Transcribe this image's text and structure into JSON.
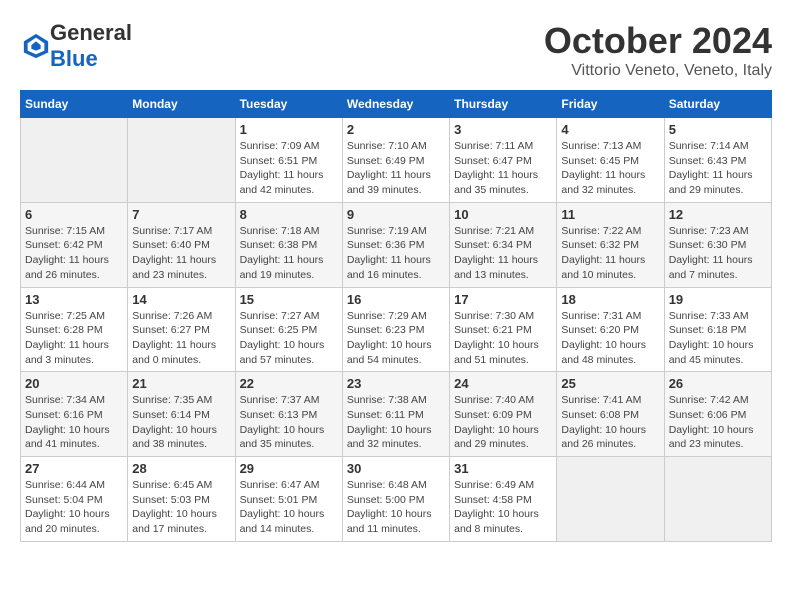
{
  "header": {
    "logo_general": "General",
    "logo_blue": "Blue",
    "month": "October 2024",
    "location": "Vittorio Veneto, Veneto, Italy"
  },
  "weekdays": [
    "Sunday",
    "Monday",
    "Tuesday",
    "Wednesday",
    "Thursday",
    "Friday",
    "Saturday"
  ],
  "weeks": [
    [
      {
        "day": "",
        "empty": true
      },
      {
        "day": "",
        "empty": true
      },
      {
        "day": "1",
        "sunrise": "Sunrise: 7:09 AM",
        "sunset": "Sunset: 6:51 PM",
        "daylight": "Daylight: 11 hours and 42 minutes."
      },
      {
        "day": "2",
        "sunrise": "Sunrise: 7:10 AM",
        "sunset": "Sunset: 6:49 PM",
        "daylight": "Daylight: 11 hours and 39 minutes."
      },
      {
        "day": "3",
        "sunrise": "Sunrise: 7:11 AM",
        "sunset": "Sunset: 6:47 PM",
        "daylight": "Daylight: 11 hours and 35 minutes."
      },
      {
        "day": "4",
        "sunrise": "Sunrise: 7:13 AM",
        "sunset": "Sunset: 6:45 PM",
        "daylight": "Daylight: 11 hours and 32 minutes."
      },
      {
        "day": "5",
        "sunrise": "Sunrise: 7:14 AM",
        "sunset": "Sunset: 6:43 PM",
        "daylight": "Daylight: 11 hours and 29 minutes."
      }
    ],
    [
      {
        "day": "6",
        "sunrise": "Sunrise: 7:15 AM",
        "sunset": "Sunset: 6:42 PM",
        "daylight": "Daylight: 11 hours and 26 minutes."
      },
      {
        "day": "7",
        "sunrise": "Sunrise: 7:17 AM",
        "sunset": "Sunset: 6:40 PM",
        "daylight": "Daylight: 11 hours and 23 minutes."
      },
      {
        "day": "8",
        "sunrise": "Sunrise: 7:18 AM",
        "sunset": "Sunset: 6:38 PM",
        "daylight": "Daylight: 11 hours and 19 minutes."
      },
      {
        "day": "9",
        "sunrise": "Sunrise: 7:19 AM",
        "sunset": "Sunset: 6:36 PM",
        "daylight": "Daylight: 11 hours and 16 minutes."
      },
      {
        "day": "10",
        "sunrise": "Sunrise: 7:21 AM",
        "sunset": "Sunset: 6:34 PM",
        "daylight": "Daylight: 11 hours and 13 minutes."
      },
      {
        "day": "11",
        "sunrise": "Sunrise: 7:22 AM",
        "sunset": "Sunset: 6:32 PM",
        "daylight": "Daylight: 11 hours and 10 minutes."
      },
      {
        "day": "12",
        "sunrise": "Sunrise: 7:23 AM",
        "sunset": "Sunset: 6:30 PM",
        "daylight": "Daylight: 11 hours and 7 minutes."
      }
    ],
    [
      {
        "day": "13",
        "sunrise": "Sunrise: 7:25 AM",
        "sunset": "Sunset: 6:28 PM",
        "daylight": "Daylight: 11 hours and 3 minutes."
      },
      {
        "day": "14",
        "sunrise": "Sunrise: 7:26 AM",
        "sunset": "Sunset: 6:27 PM",
        "daylight": "Daylight: 11 hours and 0 minutes."
      },
      {
        "day": "15",
        "sunrise": "Sunrise: 7:27 AM",
        "sunset": "Sunset: 6:25 PM",
        "daylight": "Daylight: 10 hours and 57 minutes."
      },
      {
        "day": "16",
        "sunrise": "Sunrise: 7:29 AM",
        "sunset": "Sunset: 6:23 PM",
        "daylight": "Daylight: 10 hours and 54 minutes."
      },
      {
        "day": "17",
        "sunrise": "Sunrise: 7:30 AM",
        "sunset": "Sunset: 6:21 PM",
        "daylight": "Daylight: 10 hours and 51 minutes."
      },
      {
        "day": "18",
        "sunrise": "Sunrise: 7:31 AM",
        "sunset": "Sunset: 6:20 PM",
        "daylight": "Daylight: 10 hours and 48 minutes."
      },
      {
        "day": "19",
        "sunrise": "Sunrise: 7:33 AM",
        "sunset": "Sunset: 6:18 PM",
        "daylight": "Daylight: 10 hours and 45 minutes."
      }
    ],
    [
      {
        "day": "20",
        "sunrise": "Sunrise: 7:34 AM",
        "sunset": "Sunset: 6:16 PM",
        "daylight": "Daylight: 10 hours and 41 minutes."
      },
      {
        "day": "21",
        "sunrise": "Sunrise: 7:35 AM",
        "sunset": "Sunset: 6:14 PM",
        "daylight": "Daylight: 10 hours and 38 minutes."
      },
      {
        "day": "22",
        "sunrise": "Sunrise: 7:37 AM",
        "sunset": "Sunset: 6:13 PM",
        "daylight": "Daylight: 10 hours and 35 minutes."
      },
      {
        "day": "23",
        "sunrise": "Sunrise: 7:38 AM",
        "sunset": "Sunset: 6:11 PM",
        "daylight": "Daylight: 10 hours and 32 minutes."
      },
      {
        "day": "24",
        "sunrise": "Sunrise: 7:40 AM",
        "sunset": "Sunset: 6:09 PM",
        "daylight": "Daylight: 10 hours and 29 minutes."
      },
      {
        "day": "25",
        "sunrise": "Sunrise: 7:41 AM",
        "sunset": "Sunset: 6:08 PM",
        "daylight": "Daylight: 10 hours and 26 minutes."
      },
      {
        "day": "26",
        "sunrise": "Sunrise: 7:42 AM",
        "sunset": "Sunset: 6:06 PM",
        "daylight": "Daylight: 10 hours and 23 minutes."
      }
    ],
    [
      {
        "day": "27",
        "sunrise": "Sunrise: 6:44 AM",
        "sunset": "Sunset: 5:04 PM",
        "daylight": "Daylight: 10 hours and 20 minutes."
      },
      {
        "day": "28",
        "sunrise": "Sunrise: 6:45 AM",
        "sunset": "Sunset: 5:03 PM",
        "daylight": "Daylight: 10 hours and 17 minutes."
      },
      {
        "day": "29",
        "sunrise": "Sunrise: 6:47 AM",
        "sunset": "Sunset: 5:01 PM",
        "daylight": "Daylight: 10 hours and 14 minutes."
      },
      {
        "day": "30",
        "sunrise": "Sunrise: 6:48 AM",
        "sunset": "Sunset: 5:00 PM",
        "daylight": "Daylight: 10 hours and 11 minutes."
      },
      {
        "day": "31",
        "sunrise": "Sunrise: 6:49 AM",
        "sunset": "Sunset: 4:58 PM",
        "daylight": "Daylight: 10 hours and 8 minutes."
      },
      {
        "day": "",
        "empty": true
      },
      {
        "day": "",
        "empty": true
      }
    ]
  ]
}
